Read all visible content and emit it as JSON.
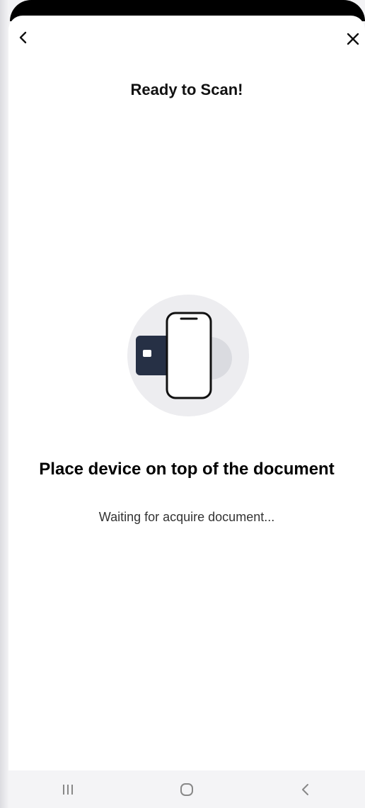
{
  "header": {
    "title": "Ready to Scan!"
  },
  "main": {
    "heading": "Place device on top of the document",
    "status": "Waiting for acquire document..."
  },
  "icons": {
    "back": "chevron-left-icon",
    "close": "close-icon",
    "illustration": "phone-card-scan-icon",
    "nav_recents": "recents-icon",
    "nav_home": "home-icon",
    "nav_back": "back-icon"
  },
  "colors": {
    "card": "#263045",
    "circle": "#ededf0",
    "accent_grey": "#dadbe0"
  }
}
